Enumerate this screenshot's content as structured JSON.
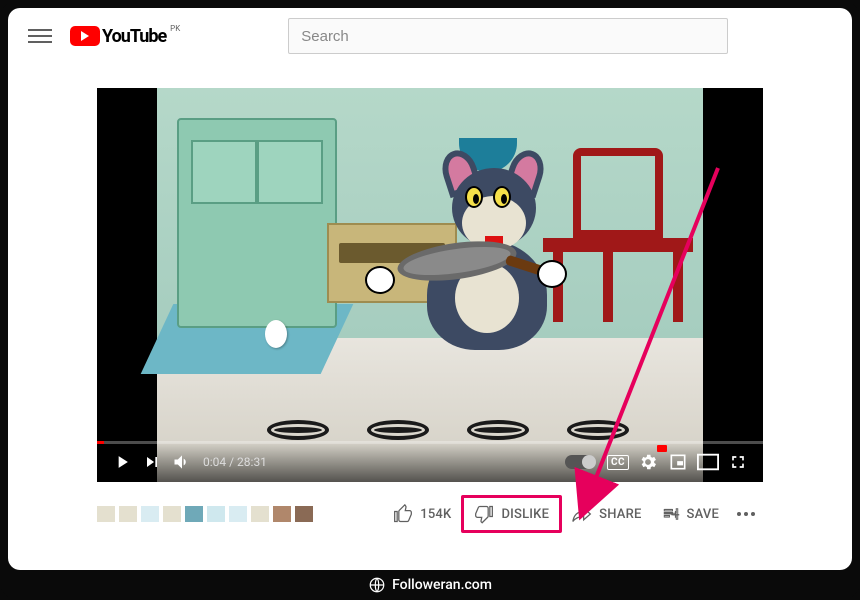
{
  "header": {
    "brand_text": "YouTube",
    "country_code": "PK",
    "search_placeholder": "Search"
  },
  "player": {
    "current_time": "0:04",
    "total_time": "28:31",
    "cc_label": "CC"
  },
  "actions": {
    "like_count": "154K",
    "dislike_label": "DISLIKE",
    "share_label": "SHARE",
    "save_label": "SAVE"
  },
  "blur_colors": [
    "#e4e0cf",
    "#e4e0cf",
    "#d9ecf2",
    "#e4e0cf",
    "#6fa9b8",
    "#cfe8ee",
    "#d9ecf2",
    "#e4e0cf",
    "#b0876b",
    "#8a6a55"
  ],
  "annotation": {
    "highlight_color": "#e6005c"
  },
  "watermark": {
    "text": "Followeran.com"
  }
}
